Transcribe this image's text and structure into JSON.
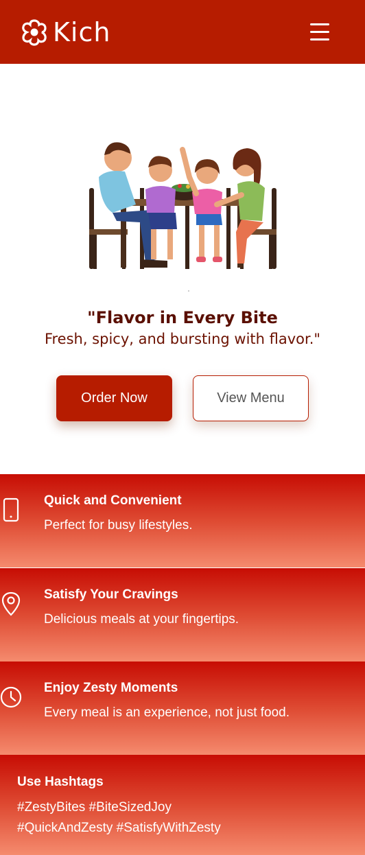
{
  "header": {
    "brand": "Kich",
    "logo_icon": "flower-logo-icon",
    "menu_icon": "hamburger-menu-icon",
    "background": "#b61c00"
  },
  "hero": {
    "image": "family-dinner-illustration",
    "quote_title": "\"Flavor in Every Bite",
    "quote_subtitle": "Fresh, spicy, and bursting with flavor.\"",
    "order_button": "Order Now",
    "menu_button": "View Menu"
  },
  "features": [
    {
      "icon": "smartphone-icon",
      "title": "Quick and Convenient",
      "description": "Perfect for busy lifestyles."
    },
    {
      "icon": "map-pin-icon",
      "title": "Satisfy Your Cravings",
      "description": "Delicious meals at your fingertips."
    },
    {
      "icon": "clock-icon",
      "title": "Enjoy Zesty Moments",
      "description": "Every meal is an experience, not just food."
    }
  ],
  "hashtags": {
    "title": "Use Hashtags",
    "line1": "#ZestyBites #BiteSizedJoy",
    "line2": "#QuickAndZesty #SatisfyWithZesty"
  },
  "colors": {
    "primary": "#b61c00",
    "quote_text": "#5a0f00",
    "gradient_top": "#c70d04",
    "gradient_bottom": "#f58b6e"
  }
}
